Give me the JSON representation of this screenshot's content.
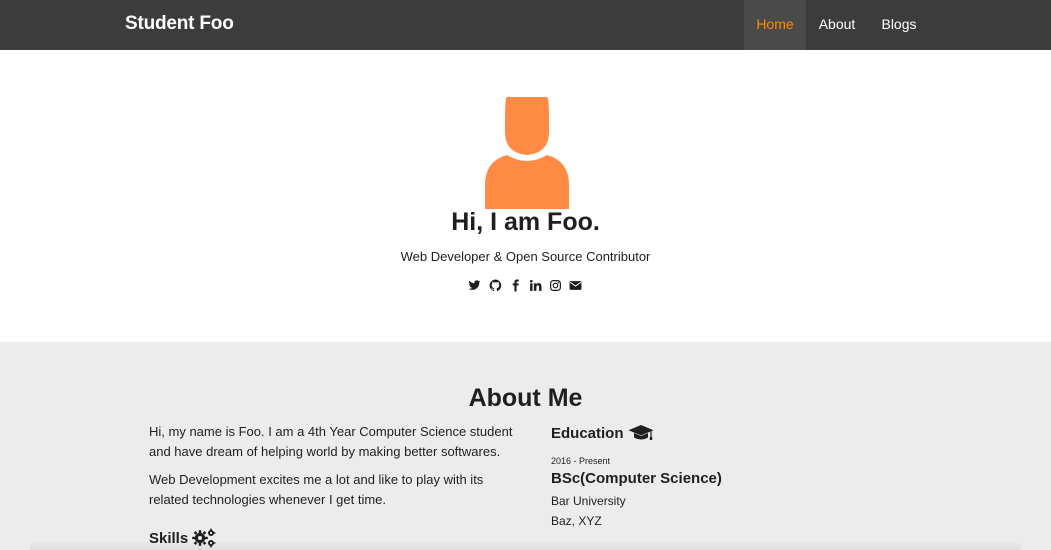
{
  "navbar": {
    "brand": "Student Foo",
    "items": [
      {
        "label": "Home",
        "active": true
      },
      {
        "label": "About"
      },
      {
        "label": "Blogs"
      }
    ],
    "accent_color": "#ff8a00",
    "background": "#3c3c3c"
  },
  "hero": {
    "avatar_icon": "user-icon",
    "avatar_color": "#ff8a44",
    "title": "Hi, I am Foo.",
    "subtitle": "Web Developer & Open Source Contributor",
    "social_icons": [
      "twitter-icon",
      "github-icon",
      "facebook-icon",
      "linkedin-icon",
      "instagram-icon",
      "email-icon"
    ]
  },
  "about": {
    "title": "About Me",
    "paragraphs": [
      "Hi, my name is Foo. I am a 4th Year Computer Science student and have dream of helping world by making better softwares.",
      "Web Development excites me a lot and like to play with its related technologies whenever I get time."
    ],
    "skills_heading": "Skills",
    "skills_icon": "gears-icon",
    "education": {
      "heading": "Education",
      "icon": "graduation-cap-icon",
      "date": "2016 - Present",
      "degree": "BSc(Computer Science)",
      "university": "Bar University",
      "location": "Baz, XYZ"
    }
  }
}
